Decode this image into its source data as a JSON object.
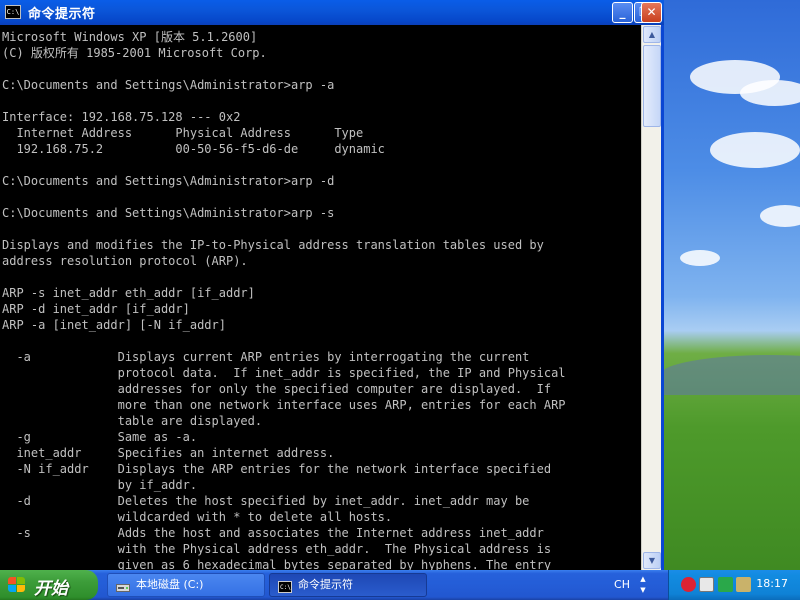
{
  "window": {
    "title": "命令提示符",
    "app_icon_text": "C:\\",
    "minimize_label": "_",
    "maximize_label": "❐",
    "close_label": "✕"
  },
  "console": {
    "lines": [
      "Microsoft Windows XP [版本 5.1.2600]",
      "(C) 版权所有 1985-2001 Microsoft Corp.",
      "",
      "C:\\Documents and Settings\\Administrator>arp -a",
      "",
      "Interface: 192.168.75.128 --- 0x2",
      "  Internet Address      Physical Address      Type",
      "  192.168.75.2          00-50-56-f5-d6-de     dynamic",
      "",
      "C:\\Documents and Settings\\Administrator>arp -d",
      "",
      "C:\\Documents and Settings\\Administrator>arp -s",
      "",
      "Displays and modifies the IP-to-Physical address translation tables used by",
      "address resolution protocol (ARP).",
      "",
      "ARP -s inet_addr eth_addr [if_addr]",
      "ARP -d inet_addr [if_addr]",
      "ARP -a [inet_addr] [-N if_addr]",
      "",
      "  -a            Displays current ARP entries by interrogating the current",
      "                protocol data.  If inet_addr is specified, the IP and Physical",
      "                addresses for only the specified computer are displayed.  If",
      "                more than one network interface uses ARP, entries for each ARP",
      "                table are displayed.",
      "  -g            Same as -a.",
      "  inet_addr     Specifies an internet address.",
      "  -N if_addr    Displays the ARP entries for the network interface specified",
      "                by if_addr.",
      "  -d            Deletes the host specified by inet_addr. inet_addr may be",
      "                wildcarded with * to delete all hosts.",
      "  -s            Adds the host and associates the Internet address inet_addr",
      "                with the Physical address eth_addr.  The Physical address is",
      "                given as 6 hexadecimal bytes separated by hyphens. The entry"
    ]
  },
  "taskbar": {
    "start_label": "开始",
    "tasks": [
      {
        "label": "本地磁盘 (C:)",
        "icon": "drive-icon",
        "active": false
      },
      {
        "label": "命令提示符",
        "icon": "cmd-icon",
        "active": true
      }
    ],
    "language": "CH",
    "clock": "18:17"
  },
  "colors": {
    "console_bg": "#000000",
    "console_fg": "#c0c0c0",
    "titlebar": "#0b56d9",
    "start_green": "#3c9c39",
    "tray_blue": "#128be0"
  }
}
